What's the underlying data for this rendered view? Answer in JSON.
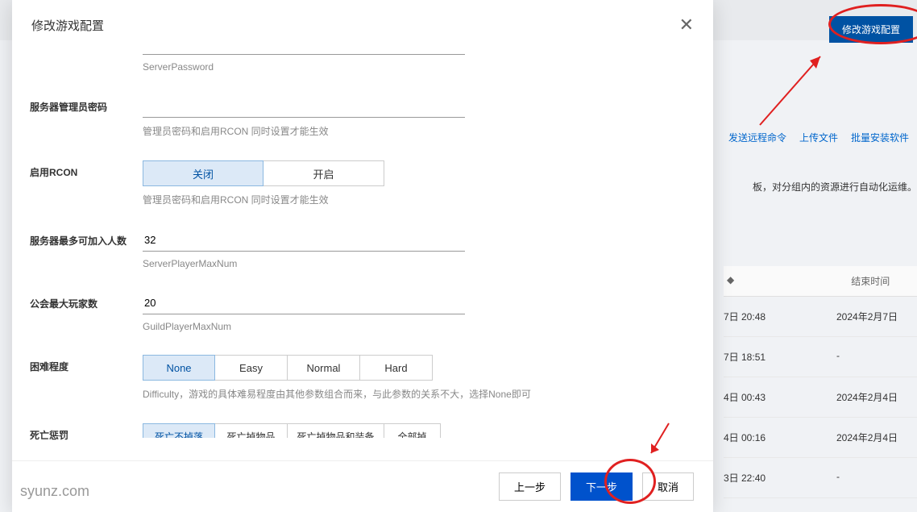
{
  "modal": {
    "title": "修改游戏配置",
    "close": "✕",
    "fields": {
      "server_password": {
        "label": "",
        "value": "",
        "help": "ServerPassword"
      },
      "admin_password": {
        "label": "服务器管理员密码",
        "value": "",
        "help": "管理员密码和启用RCON 同时设置才能生效"
      },
      "rcon": {
        "label": "启用RCON",
        "options": [
          "关闭",
          "开启"
        ],
        "selected": 0,
        "help": "管理员密码和启用RCON 同时设置才能生效"
      },
      "max_players": {
        "label": "服务器最多可加入人数",
        "value": "32",
        "help": "ServerPlayerMaxNum"
      },
      "guild_max": {
        "label": "公会最大玩家数",
        "value": "20",
        "help": "GuildPlayerMaxNum"
      },
      "difficulty": {
        "label": "困难程度",
        "options": [
          "None",
          "Easy",
          "Normal",
          "Hard"
        ],
        "selected": 0,
        "help": "Difficulty，游戏的具体难易程度由其他参数组合而来，与此参数的关系不大，选择None即可"
      },
      "death_penalty": {
        "label": "死亡惩罚",
        "options": [
          "死亡不掉落",
          "死亡掉物品",
          "死亡掉物品和装备",
          "全部掉"
        ],
        "selected": 0
      }
    },
    "footer": {
      "prev": "上一步",
      "next": "下一步",
      "cancel": "取消"
    }
  },
  "bg": {
    "config_btn": "修改游戏配置",
    "actions": [
      "发送远程命令",
      "上传文件",
      "批量安装软件"
    ],
    "desc": "板，对分组内的资源进行自动化运维。",
    "table_header_end": "结束时间",
    "rows": [
      {
        "t1": "7日 20:48",
        "t2": "2024年2月7日"
      },
      {
        "t1": "7日 18:51",
        "t2": "-"
      },
      {
        "t1": "4日 00:43",
        "t2": "2024年2月4日"
      },
      {
        "t1": "4日 00:16",
        "t2": "2024年2月4日"
      },
      {
        "t1": "3日 22:40",
        "t2": "-"
      }
    ]
  },
  "watermark": "syunz.com"
}
